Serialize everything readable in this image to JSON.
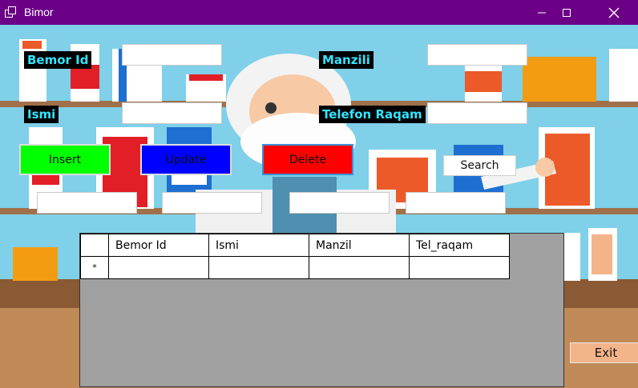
{
  "window": {
    "title": "Bimor"
  },
  "labels": {
    "bemor_id": "Bemor Id",
    "manzili": "Manzili",
    "ismi": "Ismi",
    "telefon": "Telefon Raqam"
  },
  "buttons": {
    "insert": "Insert",
    "update": "Update",
    "delete": "Delete",
    "search": "Search",
    "exit": "Exit"
  },
  "grid": {
    "columns": [
      "Bemor Id",
      "Ismi",
      "Manzil",
      "Tel_raqam"
    ],
    "new_row_marker": "*"
  },
  "colors": {
    "titlebar": "#6b0087",
    "insert": "#00ff00",
    "update": "#0000ff",
    "delete": "#ff0000",
    "label_bg": "#000000",
    "label_text": "#33e4ff"
  }
}
